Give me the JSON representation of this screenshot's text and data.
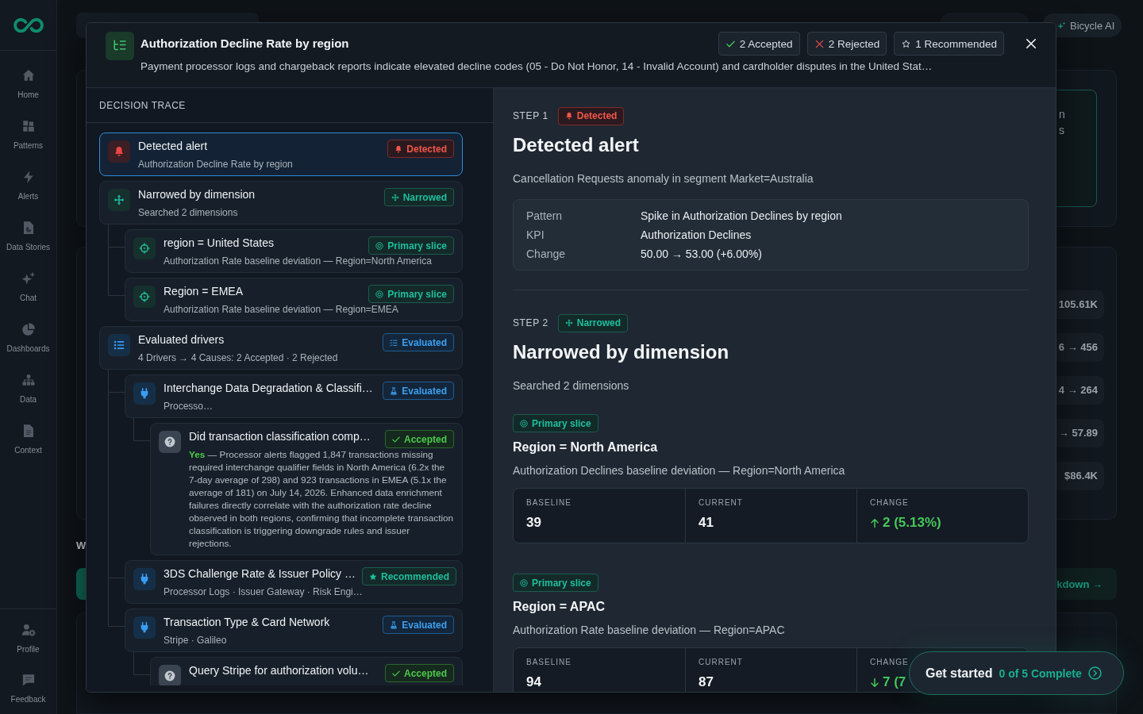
{
  "sidebar": {
    "nav_items": [
      "Home",
      "Patterns",
      "Alerts",
      "Data Stories",
      "Chat",
      "Dashboards",
      "Data",
      "Context"
    ],
    "footer_items": [
      "Profile",
      "Feedback"
    ]
  },
  "top_bar": {
    "account_button": "Bicycle AI"
  },
  "background": {
    "panel_fragments": [
      "n",
      "s"
    ],
    "metric_values": [
      "105.61K",
      "6 → 456",
      "4 → 264",
      "→ 57.89",
      "$86.4K"
    ],
    "heading_fragment": "W",
    "button_fragment": "kdown →"
  },
  "modal": {
    "title": "Authorization Decline Rate by region",
    "description": "Payment processor logs and chargeback reports indicate elevated decline codes (05 - Do Not Honor, 14 - Invalid Account) and cardholder disputes in the United Stat…",
    "summary": [
      {
        "kind": "accepted",
        "label": "2 Accepted"
      },
      {
        "kind": "rejected",
        "label": "2 Rejected"
      },
      {
        "kind": "recommended",
        "label": "1 Recommended"
      }
    ]
  },
  "trace": {
    "heading": "DECISION TRACE",
    "items": [
      {
        "kind": "alert",
        "title": "Detected alert",
        "subtitle": "Authorization Decline Rate by region",
        "badge": {
          "kind": "detected",
          "label": "Detected"
        },
        "selected": true
      },
      {
        "kind": "dimension",
        "title": "Narrowed by dimension",
        "subtitle": "Searched 2 dimensions",
        "badge": {
          "kind": "narrowed",
          "label": "Narrowed"
        },
        "selected": false,
        "children": [
          {
            "kind": "slice",
            "title": "region = United States",
            "subtitle": "Authorization Rate baseline deviation — Region=North America",
            "badge": {
              "kind": "primary",
              "label": "Primary slice"
            },
            "selected": false
          },
          {
            "kind": "slice",
            "title": "Region = EMEA",
            "subtitle": "Authorization Rate baseline deviation — Region=EMEA",
            "badge": {
              "kind": "primary",
              "label": "Primary slice"
            },
            "selected": false
          }
        ]
      },
      {
        "kind": "drivers",
        "title": "Evaluated drivers",
        "subtitle": "4 Drivers → 4 Causes: 2 Accepted · 2 Rejected",
        "badge": {
          "kind": "evaluated",
          "label": "Evaluated"
        },
        "selected": false,
        "children": [
          {
            "kind": "driver",
            "title": "Interchange Data Degradation & Classifi…",
            "subtitle": "Processo…",
            "badge": {
              "kind": "evaluated",
              "label": "Evaluated"
            },
            "selected": false,
            "children": [
              {
                "kind": "question",
                "title": "Did transaction classification comp…",
                "body": "**Yes** — Processor alerts flagged 1,847 transactions missing required interchange qualifier fields in North America (6.2x the 7-day average of 298) and 923 transactions in EMEA (5.1x the average of 181) on July 14, 2026. Enhanced data enrichment failures directly correlate with the authorization rate decline observed in both regions, confirming that incomplete transaction classification is triggering downgrade rules and issuer rejections.",
                "badge": {
                  "kind": "accepted",
                  "label": "Accepted"
                },
                "selected": false
              }
            ]
          },
          {
            "kind": "driver",
            "title": "3DS Challenge Rate & Issuer Policy …",
            "subtitle": "Processor Logs · Issuer Gateway · Risk Engi…",
            "badge": {
              "kind": "recommended",
              "label": "Recommended"
            },
            "selected": false
          },
          {
            "kind": "driver",
            "title": "Transaction Type & Card Network",
            "subtitle": "Stripe · Galileo",
            "badge": {
              "kind": "evaluated",
              "label": "Evaluated"
            },
            "selected": false,
            "children": [
              {
                "kind": "question",
                "title": "Query Stripe for authorization volu…",
                "badge": {
                  "kind": "accepted",
                  "label": "Accepted"
                },
                "selected": false
              }
            ]
          }
        ]
      }
    ]
  },
  "detail": {
    "steps": [
      {
        "kind": "alert",
        "step": "STEP 1",
        "badge": {
          "kind": "detected",
          "label": "Detected"
        },
        "title": "Detected alert",
        "description": "Cancellation Requests anomaly in segment Market=Australia",
        "facts": [
          {
            "label": "Pattern",
            "value": "Spike in Authorization Declines by region"
          },
          {
            "label": "KPI",
            "value": "Authorization Declines"
          },
          {
            "label": "Change",
            "value": "50.00 → 53.00 (+6.00%)"
          }
        ]
      },
      {
        "kind": "dimension",
        "step": "STEP 2",
        "badge": {
          "kind": "narrowed",
          "label": "Narrowed"
        },
        "title": "Narrowed by dimension",
        "description": "Searched 2 dimensions",
        "slices": [
          {
            "badge": {
              "kind": "primary",
              "label": "Primary slice"
            },
            "title": "Region = North America",
            "description": "Authorization Declines baseline deviation — Region=North America",
            "metrics": [
              {
                "kind": "plain",
                "label": "BASELINE",
                "value": "39"
              },
              {
                "kind": "plain",
                "label": "CURRENT",
                "value": "41"
              },
              {
                "kind": "increase",
                "label": "CHANGE",
                "value": "2 (5.13%)"
              }
            ]
          },
          {
            "badge": {
              "kind": "primary",
              "label": "Primary slice"
            },
            "title": "Region = APAC",
            "description": "Authorization Rate baseline deviation — Region=APAC",
            "metrics": [
              {
                "kind": "plain",
                "label": "BASELINE",
                "value": "94"
              },
              {
                "kind": "plain",
                "label": "CURRENT",
                "value": "87"
              },
              {
                "kind": "decrease",
                "label": "CHANGE",
                "value": "7 (7"
              }
            ]
          }
        ]
      }
    ]
  },
  "onboarding": {
    "title": "Get started",
    "progress": "0 of 5 Complete"
  }
}
